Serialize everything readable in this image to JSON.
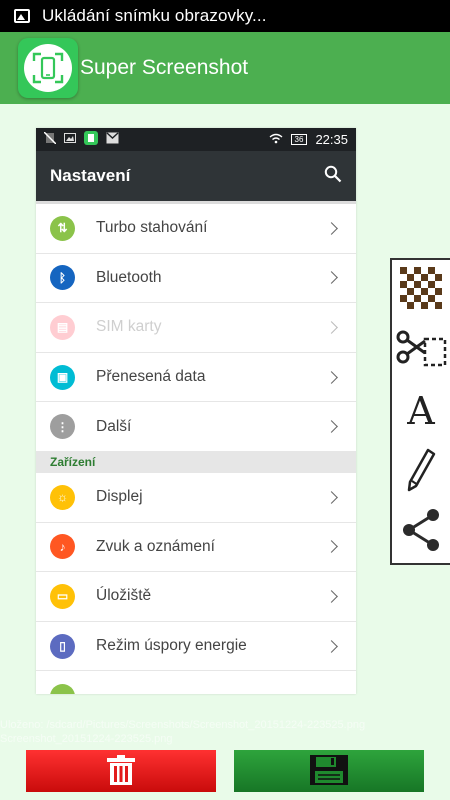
{
  "status_bar": {
    "notification_text": "Ukládání snímku obrazovky..."
  },
  "app": {
    "title": "Super Screenshot"
  },
  "preview": {
    "status_time": "22:35",
    "battery": "36",
    "toolbar_title": "Nastavení",
    "items_top": [
      {
        "label": "Turbo stahování",
        "color": "#8bc34a",
        "disabled": false
      },
      {
        "label": "Bluetooth",
        "color": "#1565c0",
        "disabled": false
      },
      {
        "label": "SIM karty",
        "color": "#ffcdd2",
        "disabled": true
      },
      {
        "label": "Přenesená data",
        "color": "#00bcd4",
        "disabled": false
      },
      {
        "label": "Další",
        "color": "#9e9e9e",
        "disabled": false
      }
    ],
    "section_title": "Zařízení",
    "items_bottom": [
      {
        "label": "Displej",
        "color": "#ffc107",
        "disabled": false
      },
      {
        "label": "Zvuk a oznámení",
        "color": "#ff5722",
        "disabled": false
      },
      {
        "label": "Úložiště",
        "color": "#ffc107",
        "disabled": false
      },
      {
        "label": "Režim úspory energie",
        "color": "#5c6bc0",
        "disabled": false
      }
    ]
  },
  "tools": [
    "mosaic-icon",
    "crop-icon",
    "text-icon",
    "pencil-icon",
    "share-icon"
  ],
  "footer": {
    "overlay_line1": "Uloženo: /sdcard/Pictures/Screenshots/Screenshot_20151224-223525.png",
    "overlay_line2": "Screenshot_20151224-223525.png"
  },
  "colors": {
    "accent": "#4caf50",
    "delete": "#e21b1b",
    "save": "#1f8a2e"
  }
}
